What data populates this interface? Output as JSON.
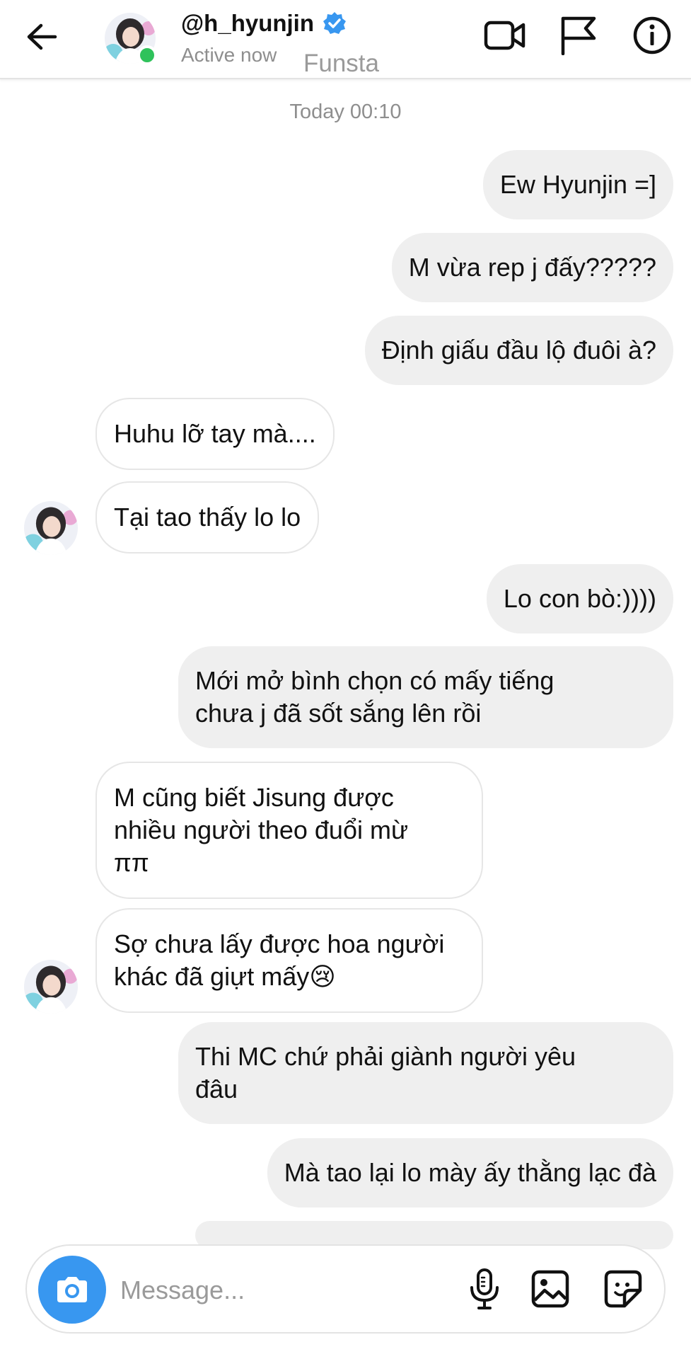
{
  "header": {
    "username": "@h_hyunjin",
    "status": "Active now",
    "label": "Funsta",
    "icons": {
      "back": "arrow-left-icon",
      "verified": "verified-badge-icon",
      "video": "video-camera-icon",
      "report": "flag-icon",
      "info": "info-icon"
    }
  },
  "conversation": {
    "timestamp": "Today 00:10",
    "messages": [
      {
        "from": "me",
        "text": "Ew Hyunjin =]"
      },
      {
        "from": "me",
        "text": "M vừa rep j đấy?????"
      },
      {
        "from": "me",
        "text": "Định giấu đầu lộ đuôi à?"
      },
      {
        "from": "them",
        "text": "Huhu lỡ tay mà...."
      },
      {
        "from": "them",
        "text": "Tại tao thấy lo lo"
      },
      {
        "from": "me",
        "text": "Lo con bò:))))"
      },
      {
        "from": "me",
        "line1": "Mới mở bình chọn có mấy tiếng",
        "line2": "chưa j đã sốt sắng lên rồi"
      },
      {
        "from": "them",
        "line1": "M cũng biết Jisung được",
        "line2": "nhiều người theo đuổi mừ",
        "line3": "ππ"
      },
      {
        "from": "them",
        "line1": "Sợ chưa lấy được hoa người",
        "line2": "khác đã giựt mấy😢"
      },
      {
        "from": "me",
        "line1": "Thi MC chứ phải giành người yêu",
        "line2": "đâu"
      },
      {
        "from": "me",
        "text": "Mà tao lại lo mày ấy thằng lạc đà"
      }
    ]
  },
  "composer": {
    "placeholder": "Message...",
    "icons": {
      "camera": "camera-icon",
      "mic": "microphone-icon",
      "gallery": "image-icon",
      "sticker": "sticker-icon"
    }
  },
  "colors": {
    "accent": "#3897f0",
    "online": "#2fc25b",
    "sent_bubble": "#efefef",
    "muted_text": "#8e8e8e"
  }
}
